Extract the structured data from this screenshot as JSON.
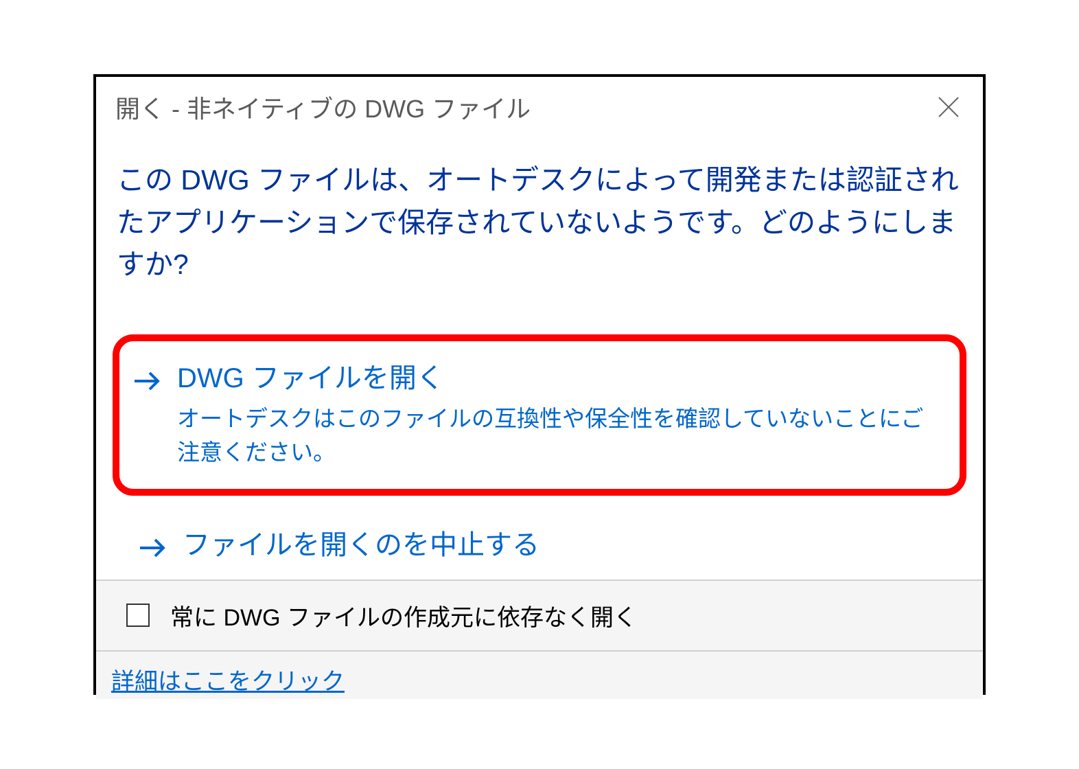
{
  "dialog": {
    "title": "開く - 非ネイティブの DWG ファイル",
    "message": "この DWG ファイルは、オートデスクによって開発または認証されたアプリケーションで保存されていないようです。どのようにしますか?",
    "options": [
      {
        "title": "DWG ファイルを開く",
        "description": "オートデスクはこのファイルの互換性や保全性を確認していないことにご注意ください。"
      },
      {
        "title": "ファイルを開くのを中止する"
      }
    ],
    "checkbox_label": "常に DWG ファイルの作成元に依存なく開く",
    "details_link": "詳細はここをクリック"
  }
}
